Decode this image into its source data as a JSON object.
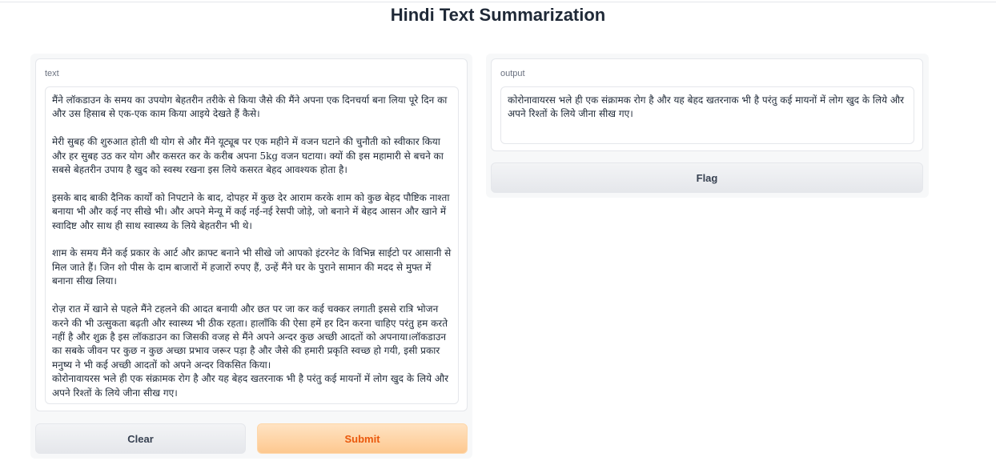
{
  "page": {
    "title": "Hindi Text Summarization"
  },
  "colors": {
    "accent_text": "#ea580c",
    "primary_button_top": "#ffe3c3",
    "primary_button_bottom": "#fdc88f",
    "secondary_button": "#e5e7eb",
    "panel_background": "#f7f8f9"
  },
  "input_panel": {
    "label": "text",
    "value": "मैंने लॉकडाउन के समय का उपयोग बेहतरीन तरीके से किया जैसे की मैंने अपना एक दिनचर्या बना लिया पूरे दिन का और उस हिसाब से एक-एक काम किया आइये देखते हैं कैसे।\n\nमेरी सुबह की शुरुआत होती थी योग से और मैंने यूट्यूब पर एक महीने में वजन घटाने की चुनौती को स्वीकार किया और हर सुबह उठ कर योग और कसरत कर के करीब अपना 5kg वजन घटाया। क्यों की इस महामारी से बचने का सबसे बेहतरीन उपाय है खुद को स्वस्थ रखना इस लिये कसरत बेहद आवश्यक होता है।\n\nइसके बाद बाकी दैनिक कार्यों को निपटाने के बाद, दोपहर में कुछ देर आराम करके शाम को कुछ बेहद पौष्टिक नाश्ता बनाया भी और कई नए सीखे भी। और अपने मेन्यू में कई नई-नई रेसपी जोड़े, जो बनाने में बेहद आसन और खाने में स्वादिष्ट और साथ ही साथ स्वास्थ्य के लिये बेहतरीन भी थे।\n\nशाम के समय मैंने कई प्रकार के आर्ट और क्राफ्ट बनाने भी सीखे जो आपको इंटरनेट के विभिन्न साईटो पर आसानी से मिल जाते हैं। जिन शो पीस के दाम बाजारों में हजारों रुपए हैं, उन्हें मैंने घर के पुराने सामान की मदद से मुफ्त में बनाना सीख लिया।\n\nरोज़ रात में खाने से पहले मैंने टहलने की आदत बनायी और छत पर जा कर कई चक्कर लगाती इससे रात्रि भोजन करने की भी उत्सुकता बढ़ती और स्वास्थ्य भी ठीक रहता। हालाँकि की ऐसा हमें हर दिन करना चाहिए परंतु हम करते नहीं है और शुक्र है इस लॉकडाउन का जिसकी वजह से मैंने अपने अन्दर कुछ अच्छी आदतों को अपनाया।लॉकडाउन का सबके जीवन पर कुछ न कुछ अच्छा प्रभाव जरूर पड़ा है और जैसे की हमारी प्रकृति स्वच्छ हो गयी, इसी प्रकार मनुष्य ने भी कई अच्छी आदतों को अपने अन्दर विकसित किया।\nकोरोनावायरस भले ही एक संक्रामक रोग है और यह बेहद खतरनाक भी है परंतु कई मायनों में लोग खुद के लिये और अपने रिश्तों के लिये जीना सीख गए।"
  },
  "buttons": {
    "clear": "Clear",
    "submit": "Submit",
    "flag": "Flag"
  },
  "output_panel": {
    "label": "output",
    "value": "कोरोनावायरस भले ही एक संक्रामक रोग है और यह बेहद खतरनाक भी है परंतु कई मायनों में लोग खुद के लिये और अपने रिश्तों के लिये जीना सीख गए।"
  }
}
